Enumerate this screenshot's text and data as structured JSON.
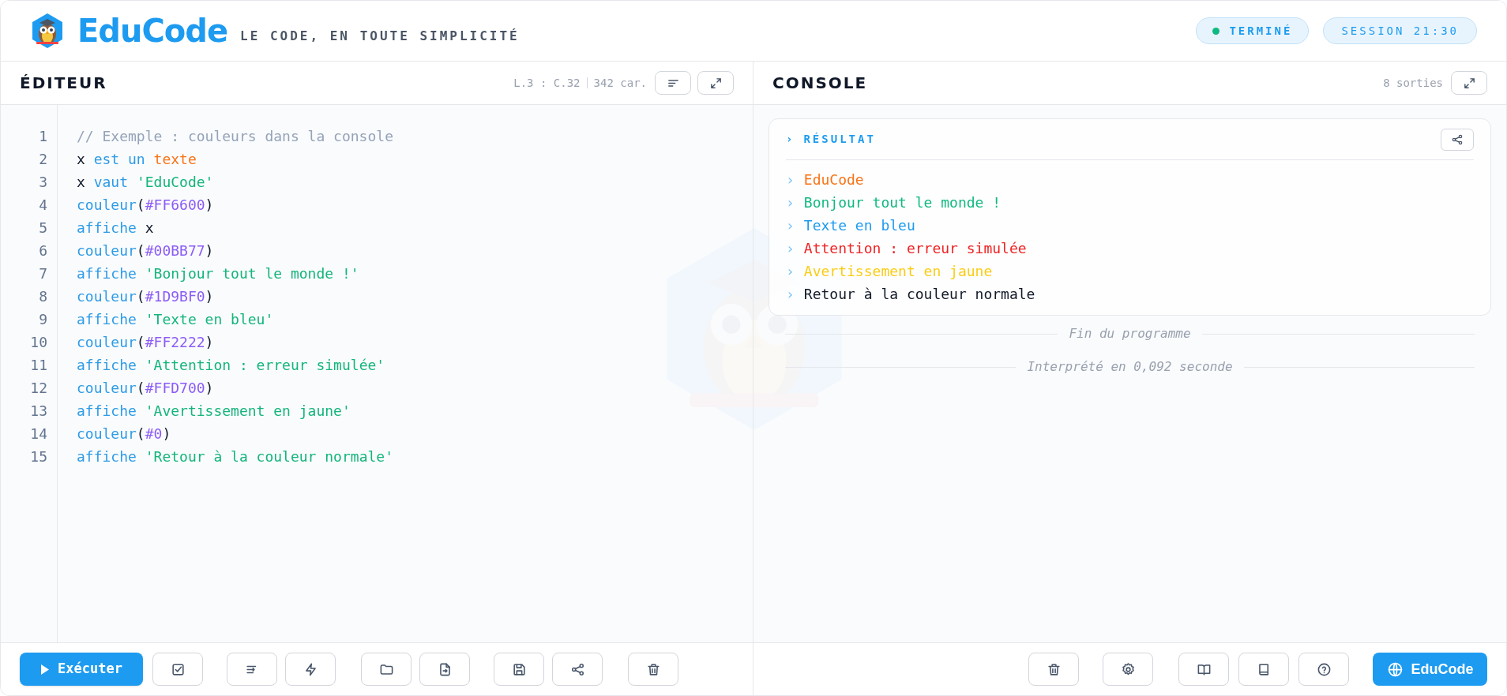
{
  "header": {
    "title": "EduCode",
    "tagline": "LE CODE, EN TOUTE SIMPLICITÉ",
    "status": {
      "label": "TERMINÉ",
      "color": "#10b981"
    },
    "session": "SESSION 21:30"
  },
  "editor": {
    "title": "ÉDITEUR",
    "stats": "L.3 : C.32",
    "char_count": "342 car.",
    "lines": [
      {
        "number": "1",
        "tokens": [
          {
            "text": "// Exemple : couleurs dans la console",
            "kind": "comment"
          }
        ]
      },
      {
        "number": "2",
        "tokens": [
          {
            "text": "x ",
            "kind": "plain"
          },
          {
            "text": "est un ",
            "kind": "keyword"
          },
          {
            "text": "texte",
            "kind": "type"
          }
        ]
      },
      {
        "number": "3",
        "tokens": [
          {
            "text": "x ",
            "kind": "plain"
          },
          {
            "text": "vaut ",
            "kind": "keyword"
          },
          {
            "text": "'EduCode'",
            "kind": "string"
          }
        ]
      },
      {
        "number": "4",
        "tokens": [
          {
            "text": "couleur",
            "kind": "keyword"
          },
          {
            "text": "(",
            "kind": "plain"
          },
          {
            "text": "#FF6600",
            "kind": "hex"
          },
          {
            "text": ")",
            "kind": "plain"
          }
        ]
      },
      {
        "number": "5",
        "tokens": [
          {
            "text": "affiche ",
            "kind": "keyword"
          },
          {
            "text": "x",
            "kind": "plain"
          }
        ]
      },
      {
        "number": "6",
        "tokens": [
          {
            "text": "couleur",
            "kind": "keyword"
          },
          {
            "text": "(",
            "kind": "plain"
          },
          {
            "text": "#00BB77",
            "kind": "hex"
          },
          {
            "text": ")",
            "kind": "plain"
          }
        ]
      },
      {
        "number": "7",
        "tokens": [
          {
            "text": "affiche ",
            "kind": "keyword"
          },
          {
            "text": "'Bonjour tout le monde !'",
            "kind": "string"
          }
        ]
      },
      {
        "number": "8",
        "tokens": [
          {
            "text": "couleur",
            "kind": "keyword"
          },
          {
            "text": "(",
            "kind": "plain"
          },
          {
            "text": "#1D9BF0",
            "kind": "hex"
          },
          {
            "text": ")",
            "kind": "plain"
          }
        ]
      },
      {
        "number": "9",
        "tokens": [
          {
            "text": "affiche ",
            "kind": "keyword"
          },
          {
            "text": "'Texte en bleu'",
            "kind": "string"
          }
        ]
      },
      {
        "number": "10",
        "tokens": [
          {
            "text": "couleur",
            "kind": "keyword"
          },
          {
            "text": "(",
            "kind": "plain"
          },
          {
            "text": "#FF2222",
            "kind": "hex"
          },
          {
            "text": ")",
            "kind": "plain"
          }
        ]
      },
      {
        "number": "11",
        "tokens": [
          {
            "text": "affiche ",
            "kind": "keyword"
          },
          {
            "text": "'Attention : erreur simulée'",
            "kind": "string"
          }
        ]
      },
      {
        "number": "12",
        "tokens": [
          {
            "text": "couleur",
            "kind": "keyword"
          },
          {
            "text": "(",
            "kind": "plain"
          },
          {
            "text": "#FFD700",
            "kind": "hex"
          },
          {
            "text": ")",
            "kind": "plain"
          }
        ]
      },
      {
        "number": "13",
        "tokens": [
          {
            "text": "affiche ",
            "kind": "keyword"
          },
          {
            "text": "'Avertissement en jaune'",
            "kind": "string"
          }
        ]
      },
      {
        "number": "14",
        "tokens": [
          {
            "text": "couleur",
            "kind": "keyword"
          },
          {
            "text": "(",
            "kind": "plain"
          },
          {
            "text": "#0",
            "kind": "hex"
          },
          {
            "text": ")",
            "kind": "plain"
          }
        ]
      },
      {
        "number": "15",
        "tokens": [
          {
            "text": "affiche ",
            "kind": "keyword"
          },
          {
            "text": "'Retour à la couleur normale'",
            "kind": "string"
          }
        ]
      }
    ],
    "run_button": "Exécuter"
  },
  "console": {
    "title": "CONSOLE",
    "output_count": "8 sorties",
    "result_heading": "RÉSULTAT",
    "marker": "›",
    "outputs": [
      {
        "text": "EduCode",
        "color": "#f97316"
      },
      {
        "text": "Bonjour tout le monde !",
        "color": "#10b981"
      },
      {
        "text": "Texte en bleu",
        "color": "#1d9bf0"
      },
      {
        "text": "Attention : erreur simulée",
        "color": "#ef2222"
      },
      {
        "text": "Avertissement en jaune",
        "color": "#facc15"
      },
      {
        "text": "Retour à la couleur normale",
        "color": "#111827"
      }
    ],
    "end_note": "Fin du programme",
    "timing": "Interprété en 0,092 seconde",
    "brand_button": "EduCode"
  }
}
